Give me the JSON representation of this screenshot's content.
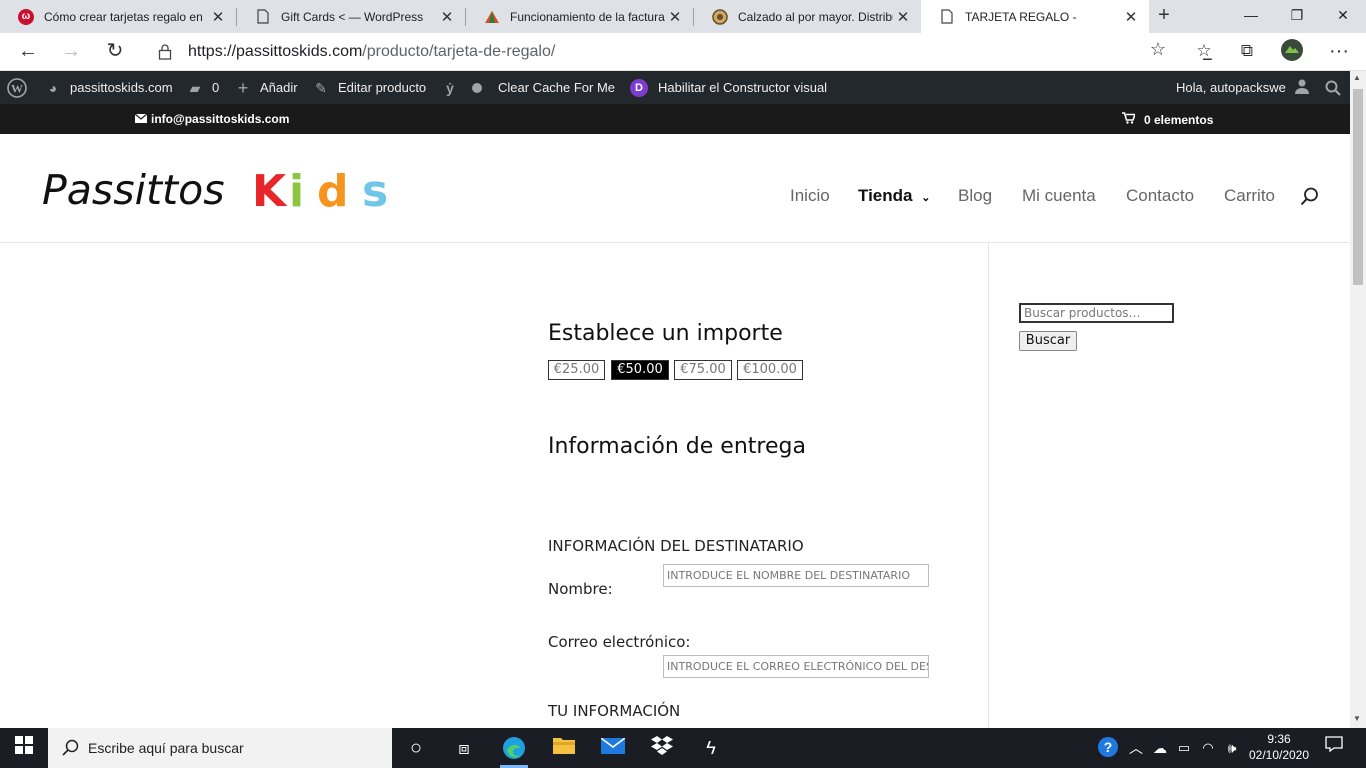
{
  "browser": {
    "tabs": [
      {
        "title": "Cómo crear tarjetas regalo en ",
        "icon": "red-w-favicon",
        "active": false
      },
      {
        "title": "Gift Cards < — WordPress",
        "icon": "document-favicon",
        "active": false
      },
      {
        "title": "Funcionamiento de la facturac",
        "icon": "triangle-favicon",
        "active": false
      },
      {
        "title": "Calzado al por mayor. Distribu",
        "icon": "round-favicon",
        "active": false
      },
      {
        "title": "TARJETA REGALO -",
        "icon": "document-favicon",
        "active": true
      }
    ],
    "url_host": "https://passittoskids.com",
    "url_path": "/producto/tarjeta-de-regalo/"
  },
  "adminbar": {
    "site": "passittoskids.com",
    "comments_count": "0",
    "add_new": "Añadir",
    "edit_product": "Editar producto",
    "clear_cache": "Clear Cache For Me",
    "visual_builder": "Habilitar el Constructor visual",
    "greeting": "Hola, autopackswe"
  },
  "infobar": {
    "email": "info@passittoskids.com",
    "cart": "0 elementos"
  },
  "header": {
    "logo_part1": "Passittos",
    "logo_part2": [
      "K",
      "i",
      "d",
      "s"
    ],
    "logo_colors": [
      "#e8262a",
      "#8cc63f",
      "#f7941d",
      "#6ec6e8"
    ],
    "menu": [
      {
        "label": "Inicio",
        "current": false
      },
      {
        "label": "Tienda",
        "current": true
      },
      {
        "label": "Blog",
        "current": false
      },
      {
        "label": "Mi cuenta",
        "current": false
      },
      {
        "label": "Contacto",
        "current": false
      },
      {
        "label": "Carrito",
        "current": false
      }
    ]
  },
  "product": {
    "amount_heading": "Establece un importe",
    "amounts": [
      "€25.00",
      "€50.00",
      "€75.00",
      "€100.00"
    ],
    "selected_amount": "€50.00",
    "delivery_heading": "Información de entrega",
    "recipient_heading": "INFORMACIÓN DEL DESTINATARIO",
    "name_label": "Nombre:",
    "name_placeholder": "INTRODUCE EL NOMBRE DEL DESTINATARIO",
    "email_label": "Correo electrónico:",
    "email_placeholder": "INTRODUCE EL CORREO ELECTRÓNICO DEL DESTINATARIO",
    "your_info_heading": "TU INFORMACIÓN"
  },
  "sidebar": {
    "search_placeholder": "Buscar productos…",
    "search_button": "Buscar"
  },
  "taskbar": {
    "search_text": "Escribe aquí para buscar",
    "time": "9:36",
    "date": "02/10/2020"
  }
}
